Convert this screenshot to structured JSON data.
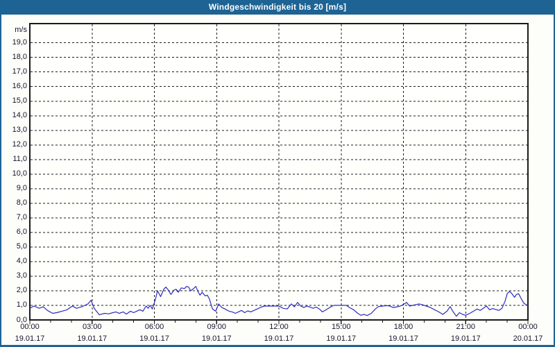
{
  "title_bar": {
    "title": "Windgeschwindigkeit bis 20 [m/s]"
  },
  "colors": {
    "titlebar_bg": "#1d6394",
    "window_border": "#1d6394",
    "plot_bg": "#fffffc",
    "frame": "#1a1a1a",
    "grid": "#1a1a1a",
    "line": "#2a2ac0",
    "label": "#14142d"
  },
  "chart_data": {
    "type": "line",
    "title": "Windgeschwindigkeit bis 20 [m/s]",
    "ylabel": "m/s",
    "xlabel": "",
    "ylim": [
      0,
      20.3
    ],
    "xlim_hours": [
      0,
      24
    ],
    "grid": true,
    "legend_position": "none",
    "y_unit_label": "m/s",
    "y_ticks": [
      {
        "v": 0,
        "label": "0,0"
      },
      {
        "v": 1,
        "label": "1,0"
      },
      {
        "v": 2,
        "label": "2,0"
      },
      {
        "v": 3,
        "label": "3,0"
      },
      {
        "v": 4,
        "label": "4,0"
      },
      {
        "v": 5,
        "label": "5,0"
      },
      {
        "v": 6,
        "label": "6,0"
      },
      {
        "v": 7,
        "label": "7,0"
      },
      {
        "v": 8,
        "label": "8,0"
      },
      {
        "v": 9,
        "label": "9,0"
      },
      {
        "v": 10,
        "label": "10,0"
      },
      {
        "v": 11,
        "label": "11,0"
      },
      {
        "v": 12,
        "label": "12,0"
      },
      {
        "v": 13,
        "label": "13,0"
      },
      {
        "v": 14,
        "label": "14,0"
      },
      {
        "v": 15,
        "label": "15,0"
      },
      {
        "v": 16,
        "label": "16,0"
      },
      {
        "v": 17,
        "label": "17,0"
      },
      {
        "v": 18,
        "label": "18,0"
      },
      {
        "v": 19,
        "label": "19,0"
      }
    ],
    "x_ticks": [
      {
        "h": 0,
        "time": "00:00",
        "date": "19.01.17"
      },
      {
        "h": 3,
        "time": "03:00",
        "date": "19.01.17"
      },
      {
        "h": 6,
        "time": "06:00",
        "date": "19.01.17"
      },
      {
        "h": 9,
        "time": "09:00",
        "date": "19.01.17"
      },
      {
        "h": 12,
        "time": "12:00",
        "date": "19.01.17"
      },
      {
        "h": 15,
        "time": "15:00",
        "date": "19.01.17"
      },
      {
        "h": 18,
        "time": "18:00",
        "date": "19.01.17"
      },
      {
        "h": 21,
        "time": "21:00",
        "date": "19.01.17"
      },
      {
        "h": 24,
        "time": "00:00",
        "date": "20.01.17"
      }
    ],
    "minor_x_tick_every_hours": 1,
    "series": [
      {
        "name": "Windgeschwindigkeit",
        "points": [
          [
            0.0,
            0.8
          ],
          [
            0.2,
            0.95
          ],
          [
            0.45,
            0.8
          ],
          [
            0.65,
            0.9
          ],
          [
            0.85,
            0.65
          ],
          [
            1.1,
            0.45
          ],
          [
            1.3,
            0.5
          ],
          [
            1.55,
            0.6
          ],
          [
            1.8,
            0.7
          ],
          [
            2.05,
            0.95
          ],
          [
            2.25,
            0.8
          ],
          [
            2.5,
            0.9
          ],
          [
            2.65,
            1.0
          ],
          [
            2.8,
            1.1
          ],
          [
            2.95,
            1.35
          ],
          [
            3.1,
            0.8
          ],
          [
            3.35,
            0.35
          ],
          [
            3.6,
            0.45
          ],
          [
            3.8,
            0.42
          ],
          [
            4.0,
            0.5
          ],
          [
            4.15,
            0.55
          ],
          [
            4.3,
            0.45
          ],
          [
            4.5,
            0.55
          ],
          [
            4.65,
            0.4
          ],
          [
            4.85,
            0.6
          ],
          [
            5.0,
            0.5
          ],
          [
            5.15,
            0.6
          ],
          [
            5.3,
            0.7
          ],
          [
            5.45,
            0.6
          ],
          [
            5.6,
            0.95
          ],
          [
            5.7,
            0.8
          ],
          [
            5.8,
            1.0
          ],
          [
            5.9,
            0.75
          ],
          [
            6.05,
            1.4
          ],
          [
            6.15,
            2.0
          ],
          [
            6.3,
            1.6
          ],
          [
            6.45,
            2.1
          ],
          [
            6.55,
            2.25
          ],
          [
            6.65,
            2.1
          ],
          [
            6.8,
            1.75
          ],
          [
            6.95,
            2.05
          ],
          [
            7.05,
            2.1
          ],
          [
            7.15,
            1.9
          ],
          [
            7.3,
            2.2
          ],
          [
            7.45,
            2.15
          ],
          [
            7.55,
            2.3
          ],
          [
            7.65,
            2.25
          ],
          [
            7.75,
            2.0
          ],
          [
            7.85,
            2.1
          ],
          [
            8.0,
            2.3
          ],
          [
            8.1,
            1.95
          ],
          [
            8.2,
            1.7
          ],
          [
            8.3,
            1.9
          ],
          [
            8.45,
            1.65
          ],
          [
            8.55,
            1.7
          ],
          [
            8.65,
            1.45
          ],
          [
            8.8,
            0.75
          ],
          [
            8.95,
            0.6
          ],
          [
            9.1,
            1.1
          ],
          [
            9.25,
            0.85
          ],
          [
            9.4,
            0.75
          ],
          [
            9.6,
            0.6
          ],
          [
            9.75,
            0.55
          ],
          [
            9.9,
            0.45
          ],
          [
            10.05,
            0.55
          ],
          [
            10.2,
            0.65
          ],
          [
            10.35,
            0.5
          ],
          [
            10.5,
            0.62
          ],
          [
            10.65,
            0.55
          ],
          [
            10.8,
            0.65
          ],
          [
            11.0,
            0.78
          ],
          [
            11.15,
            0.88
          ],
          [
            11.3,
            0.95
          ],
          [
            11.55,
            0.95
          ],
          [
            11.8,
            0.95
          ],
          [
            12.0,
            0.95
          ],
          [
            12.2,
            0.8
          ],
          [
            12.4,
            0.75
          ],
          [
            12.6,
            1.1
          ],
          [
            12.75,
            0.9
          ],
          [
            12.9,
            1.2
          ],
          [
            13.05,
            0.95
          ],
          [
            13.2,
            0.85
          ],
          [
            13.35,
            0.95
          ],
          [
            13.5,
            0.88
          ],
          [
            13.65,
            0.8
          ],
          [
            13.8,
            0.88
          ],
          [
            13.95,
            0.75
          ],
          [
            14.1,
            0.55
          ],
          [
            14.3,
            0.72
          ],
          [
            14.5,
            0.9
          ],
          [
            14.65,
            1.0
          ],
          [
            14.85,
            1.0
          ],
          [
            15.05,
            1.0
          ],
          [
            15.25,
            1.0
          ],
          [
            15.4,
            0.85
          ],
          [
            15.6,
            0.7
          ],
          [
            15.8,
            0.45
          ],
          [
            15.95,
            0.32
          ],
          [
            16.1,
            0.38
          ],
          [
            16.25,
            0.3
          ],
          [
            16.45,
            0.45
          ],
          [
            16.65,
            0.75
          ],
          [
            16.8,
            0.92
          ],
          [
            17.0,
            0.95
          ],
          [
            17.2,
            0.98
          ],
          [
            17.35,
            0.95
          ],
          [
            17.5,
            0.85
          ],
          [
            17.7,
            0.9
          ],
          [
            17.85,
            0.95
          ],
          [
            18.05,
            1.1
          ],
          [
            18.15,
            1.2
          ],
          [
            18.3,
            0.95
          ],
          [
            18.45,
            1.0
          ],
          [
            18.6,
            1.05
          ],
          [
            18.75,
            1.1
          ],
          [
            18.9,
            1.05
          ],
          [
            19.1,
            0.95
          ],
          [
            19.3,
            0.85
          ],
          [
            19.5,
            0.7
          ],
          [
            19.7,
            0.55
          ],
          [
            19.9,
            0.38
          ],
          [
            20.1,
            0.6
          ],
          [
            20.25,
            0.92
          ],
          [
            20.4,
            0.55
          ],
          [
            20.55,
            0.25
          ],
          [
            20.7,
            0.5
          ],
          [
            20.85,
            0.38
          ],
          [
            21.0,
            0.32
          ],
          [
            21.2,
            0.45
          ],
          [
            21.4,
            0.62
          ],
          [
            21.55,
            0.75
          ],
          [
            21.7,
            0.65
          ],
          [
            21.85,
            0.8
          ],
          [
            22.0,
            0.95
          ],
          [
            22.15,
            0.7
          ],
          [
            22.3,
            0.78
          ],
          [
            22.45,
            0.72
          ],
          [
            22.6,
            0.65
          ],
          [
            22.75,
            0.8
          ],
          [
            22.9,
            1.3
          ],
          [
            23.0,
            1.8
          ],
          [
            23.1,
            1.95
          ],
          [
            23.2,
            1.85
          ],
          [
            23.35,
            1.55
          ],
          [
            23.45,
            1.75
          ],
          [
            23.55,
            1.8
          ],
          [
            23.7,
            1.4
          ],
          [
            23.8,
            1.15
          ],
          [
            23.9,
            1.05
          ],
          [
            24.0,
            1.0
          ]
        ]
      }
    ]
  }
}
